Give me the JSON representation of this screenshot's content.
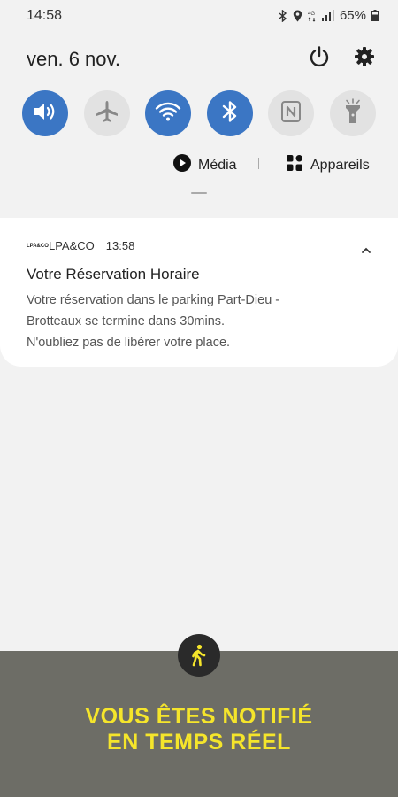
{
  "status_bar": {
    "time": "14:58",
    "battery": "65%",
    "icons": [
      "bluetooth-icon",
      "location-icon",
      "lte-icon",
      "signal-icon",
      "battery-icon"
    ]
  },
  "header": {
    "date": "ven. 6 nov.",
    "icons": [
      "power-icon",
      "gear-icon"
    ]
  },
  "quick_settings": [
    {
      "name": "sound",
      "icon": "volume-icon",
      "state": "on"
    },
    {
      "name": "airplane",
      "icon": "airplane-icon",
      "state": "off"
    },
    {
      "name": "wifi",
      "icon": "wifi-icon",
      "state": "on"
    },
    {
      "name": "bluetooth",
      "icon": "bluetooth-icon",
      "state": "on"
    },
    {
      "name": "nfc",
      "icon": "nfc-icon",
      "state": "off"
    },
    {
      "name": "flashlight",
      "icon": "flashlight-icon",
      "state": "off"
    }
  ],
  "media_bar": {
    "media_label": "Média",
    "devices_label": "Appareils"
  },
  "notification": {
    "app_logo": "LPA&CO",
    "app_name": "LPA&CO",
    "time": "13:58",
    "title": "Votre Réservation Horaire",
    "body_lines": [
      "Votre réservation dans le parking Part-Dieu -",
      "Brotteaux se termine dans 30mins.",
      "N'oubliez pas de libérer votre place."
    ]
  },
  "promo": {
    "icon": "walking-person-icon",
    "line1": "VOUS ÊTES NOTIFIÉ",
    "line2": "EN TEMPS RÉEL"
  },
  "colors": {
    "accent": "#3b76c4",
    "inactive": "#e2e2e2",
    "background": "#f2f2f2",
    "promo_bg": "#6d6d66",
    "promo_text": "#f5e52b"
  }
}
